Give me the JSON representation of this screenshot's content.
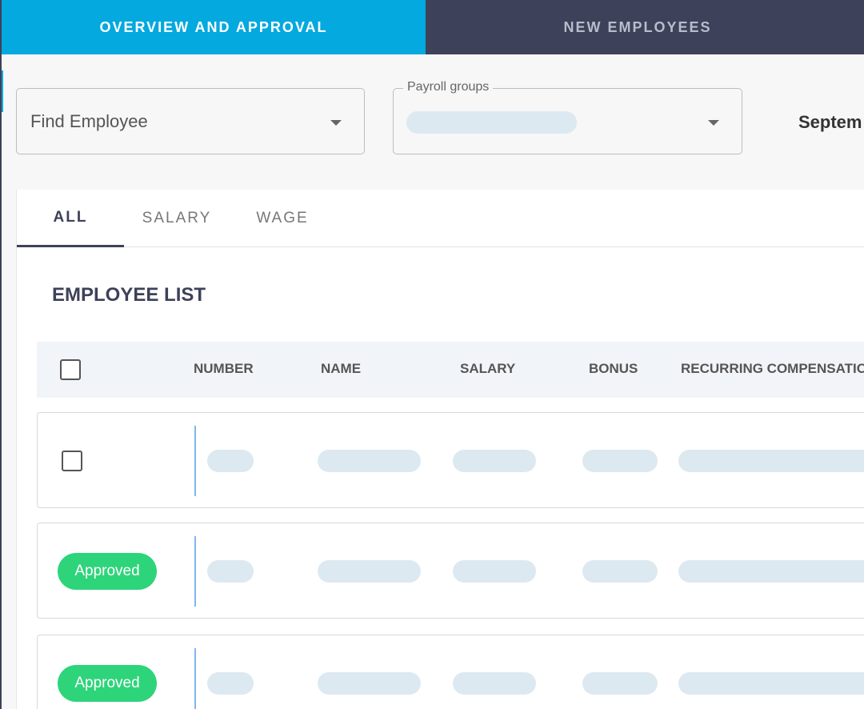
{
  "top_tabs": {
    "overview": "OVERVIEW AND APPROVAL",
    "new_employees": "NEW EMPLOYEES"
  },
  "filters": {
    "find_employee": "Find Employee",
    "payroll_groups_label": "Payroll groups",
    "period_label": "Septem"
  },
  "sub_tabs": {
    "all": "ALL",
    "salary": "SALARY",
    "wage": "WAGE"
  },
  "employee_list": {
    "title": "EMPLOYEE LIST",
    "columns": [
      "NUMBER",
      "NAME",
      "SALARY",
      "BONUS",
      "RECURRING COMPENSATION"
    ],
    "rows": [
      {
        "status": null
      },
      {
        "status": "Approved"
      },
      {
        "status": "Approved"
      }
    ]
  },
  "colors": {
    "active_tab": "#03a9df",
    "nav_bg": "#3d4159",
    "approved": "#2ed47a",
    "skeleton": "#dde9f1"
  }
}
